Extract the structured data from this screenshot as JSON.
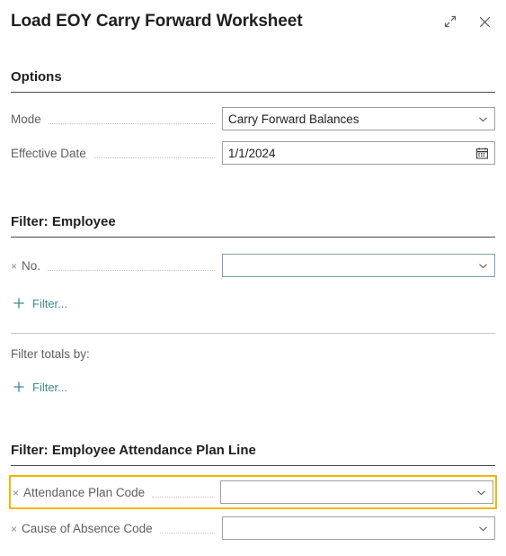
{
  "dialog": {
    "title": "Load EOY Carry Forward Worksheet",
    "expand_icon": "expand-diagonal-icon",
    "close_icon": "close-x-icon"
  },
  "colors": {
    "focus_ring": "#f2b705",
    "link_teal": "#3e8a8f",
    "heading_rule": "#494847",
    "light_rule": "#c8c6c4",
    "control_border": "#a19f9d",
    "control_border_active": "#7f9fae"
  },
  "options": {
    "heading": "Options",
    "fields": [
      {
        "label": "Mode",
        "value": "Carry Forward Balances",
        "placeholder": "",
        "control": "dropdown",
        "icon": "chevron-down-icon"
      },
      {
        "label": "Effective Date",
        "value": "1/1/2024",
        "placeholder": "",
        "control": "date",
        "icon": "calendar-icon"
      }
    ]
  },
  "filter_employee": {
    "heading": "Filter: Employee",
    "fields": [
      {
        "label": "No.",
        "value": "",
        "placeholder": "",
        "control": "dropdown",
        "icon": "chevron-down-icon",
        "remove_icon": "close-x-icon"
      }
    ],
    "add_filter_label": "Filter...",
    "add_filter_icon": "plus-icon"
  },
  "filter_totals": {
    "label": "Filter totals by:",
    "add_filter_label": "Filter...",
    "add_filter_icon": "plus-icon"
  },
  "filter_plan_line": {
    "heading": "Filter: Employee Attendance Plan Line",
    "fields": [
      {
        "label": "Attendance Plan Code",
        "value": "",
        "placeholder": "",
        "control": "dropdown",
        "icon": "chevron-down-icon",
        "remove_icon": "close-x-icon",
        "focused": true
      },
      {
        "label": "Cause of Absence Code",
        "value": "",
        "placeholder": "",
        "control": "dropdown",
        "icon": "chevron-down-icon",
        "remove_icon": "close-x-icon",
        "focused": false
      }
    ]
  },
  "glyphs": {
    "x": "×"
  }
}
